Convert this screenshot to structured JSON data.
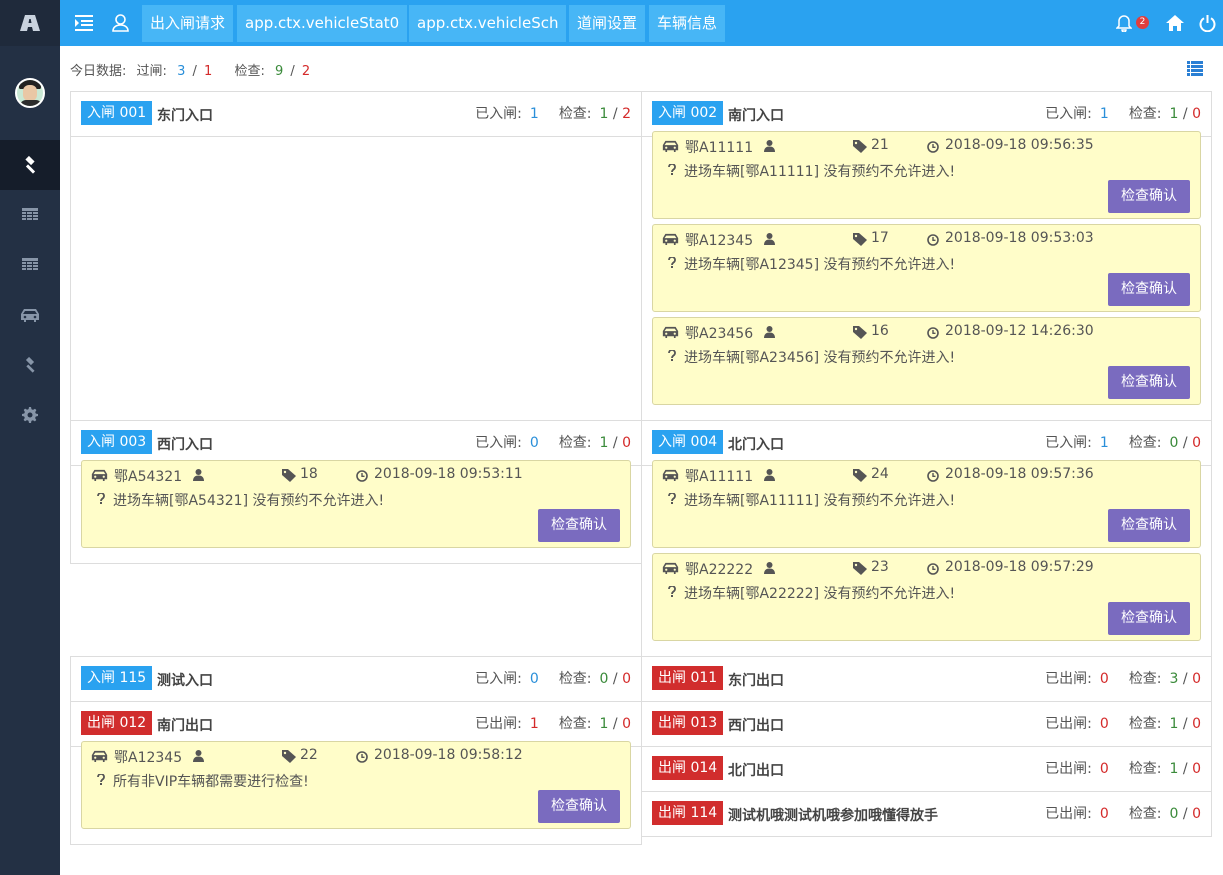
{
  "topbar": {
    "tabs": [
      "出入闸请求",
      "app.ctx.vehicleStat0",
      "app.ctx.vehicleSch",
      "道闸设置",
      "车辆信息"
    ],
    "notification_count": "2"
  },
  "summary": {
    "label": "今日数据:",
    "pass_label": "过闸:",
    "pass_a": "3",
    "pass_b": "1",
    "check_label": "检查:",
    "check_a": "9",
    "check_b": "2"
  },
  "gates": [
    {
      "badge": "入闸 001",
      "name": "东门入口",
      "stat_label": "已入闸:",
      "count": "1",
      "check_label": "检查:",
      "check_a": "1",
      "check_b": "2",
      "records": []
    },
    {
      "badge": "入闸 002",
      "name": "南门入口",
      "stat_label": "已入闸:",
      "count": "1",
      "check_label": "检查:",
      "check_a": "1",
      "check_b": "0",
      "records": [
        {
          "plate": "鄂A11111",
          "count": "21",
          "time": "2018-09-18 09:56:35",
          "msg": "进场车辆[鄂A11111] 没有预约不允许进入!",
          "btn": "检查确认"
        },
        {
          "plate": "鄂A12345",
          "count": "17",
          "time": "2018-09-18 09:53:03",
          "msg": "进场车辆[鄂A12345] 没有预约不允许进入!",
          "btn": "检查确认"
        },
        {
          "plate": "鄂A23456",
          "count": "16",
          "time": "2018-09-12 14:26:30",
          "msg": "进场车辆[鄂A23456] 没有预约不允许进入!",
          "btn": "检查确认"
        }
      ]
    },
    {
      "badge": "入闸 003",
      "name": "西门入口",
      "stat_label": "已入闸:",
      "count": "0",
      "check_label": "检查:",
      "check_a": "1",
      "check_b": "0",
      "records": [
        {
          "plate": "鄂A54321",
          "count": "18",
          "time": "2018-09-18 09:53:11",
          "msg": "进场车辆[鄂A54321] 没有预约不允许进入!",
          "btn": "检查确认"
        }
      ]
    },
    {
      "badge": "入闸 004",
      "name": "北门入口",
      "stat_label": "已入闸:",
      "count": "1",
      "check_label": "检查:",
      "check_a": "0",
      "check_b": "0",
      "records": [
        {
          "plate": "鄂A11111",
          "count": "24",
          "time": "2018-09-18 09:57:36",
          "msg": "进场车辆[鄂A11111] 没有预约不允许进入!",
          "btn": "检查确认"
        },
        {
          "plate": "鄂A22222",
          "count": "23",
          "time": "2018-09-18 09:57:29",
          "msg": "进场车辆[鄂A22222] 没有预约不允许进入!",
          "btn": "检查确认"
        }
      ]
    },
    {
      "badge": "入闸 115",
      "name": "测试入口",
      "stat_label": "已入闸:",
      "count": "0",
      "check_label": "检查:",
      "check_a": "0",
      "check_b": "0",
      "records": []
    },
    {
      "badge": "出闸 012",
      "name": "南门出口",
      "stat_label": "已出闸:",
      "count": "1",
      "check_label": "检查:",
      "check_a": "1",
      "check_b": "0",
      "records": [
        {
          "plate": "鄂A12345",
          "count": "22",
          "time": "2018-09-18 09:58:12",
          "msg": "所有非VIP车辆都需要进行检查!",
          "btn": "检查确认"
        }
      ]
    },
    {
      "badge": "出闸 011",
      "name": "东门出口",
      "stat_label": "已出闸:",
      "count": "0",
      "check_label": "检查:",
      "check_a": "3",
      "check_b": "0",
      "records": []
    },
    {
      "badge": "出闸 013",
      "name": "西门出口",
      "stat_label": "已出闸:",
      "count": "0",
      "check_label": "检查:",
      "check_a": "1",
      "check_b": "0",
      "records": []
    },
    {
      "badge": "出闸 014",
      "name": "北门出口",
      "stat_label": "已出闸:",
      "count": "0",
      "check_label": "检查:",
      "check_a": "1",
      "check_b": "0",
      "records": []
    },
    {
      "badge": "出闸 114",
      "name": "测试机哦测试机哦参加哦懂得放手",
      "stat_label": "已出闸:",
      "count": "0",
      "check_label": "检查:",
      "check_a": "0",
      "check_b": "0",
      "records": []
    }
  ],
  "colors": {
    "topbar": "#2aa2f0",
    "sidebar": "#233044",
    "in_badge": "#2aa2f0",
    "out_badge": "#d12d2d",
    "card_bg": "#fffdc9",
    "button": "#7a6bbf"
  },
  "icons": [
    "logo-icon",
    "menu-toggle-icon",
    "user-icon",
    "gavel-icon",
    "table-icon",
    "car-icon",
    "settings-icon",
    "bell-icon",
    "home-icon",
    "power-icon",
    "list-icon",
    "tag-icon",
    "clock-icon",
    "question-icon"
  ]
}
